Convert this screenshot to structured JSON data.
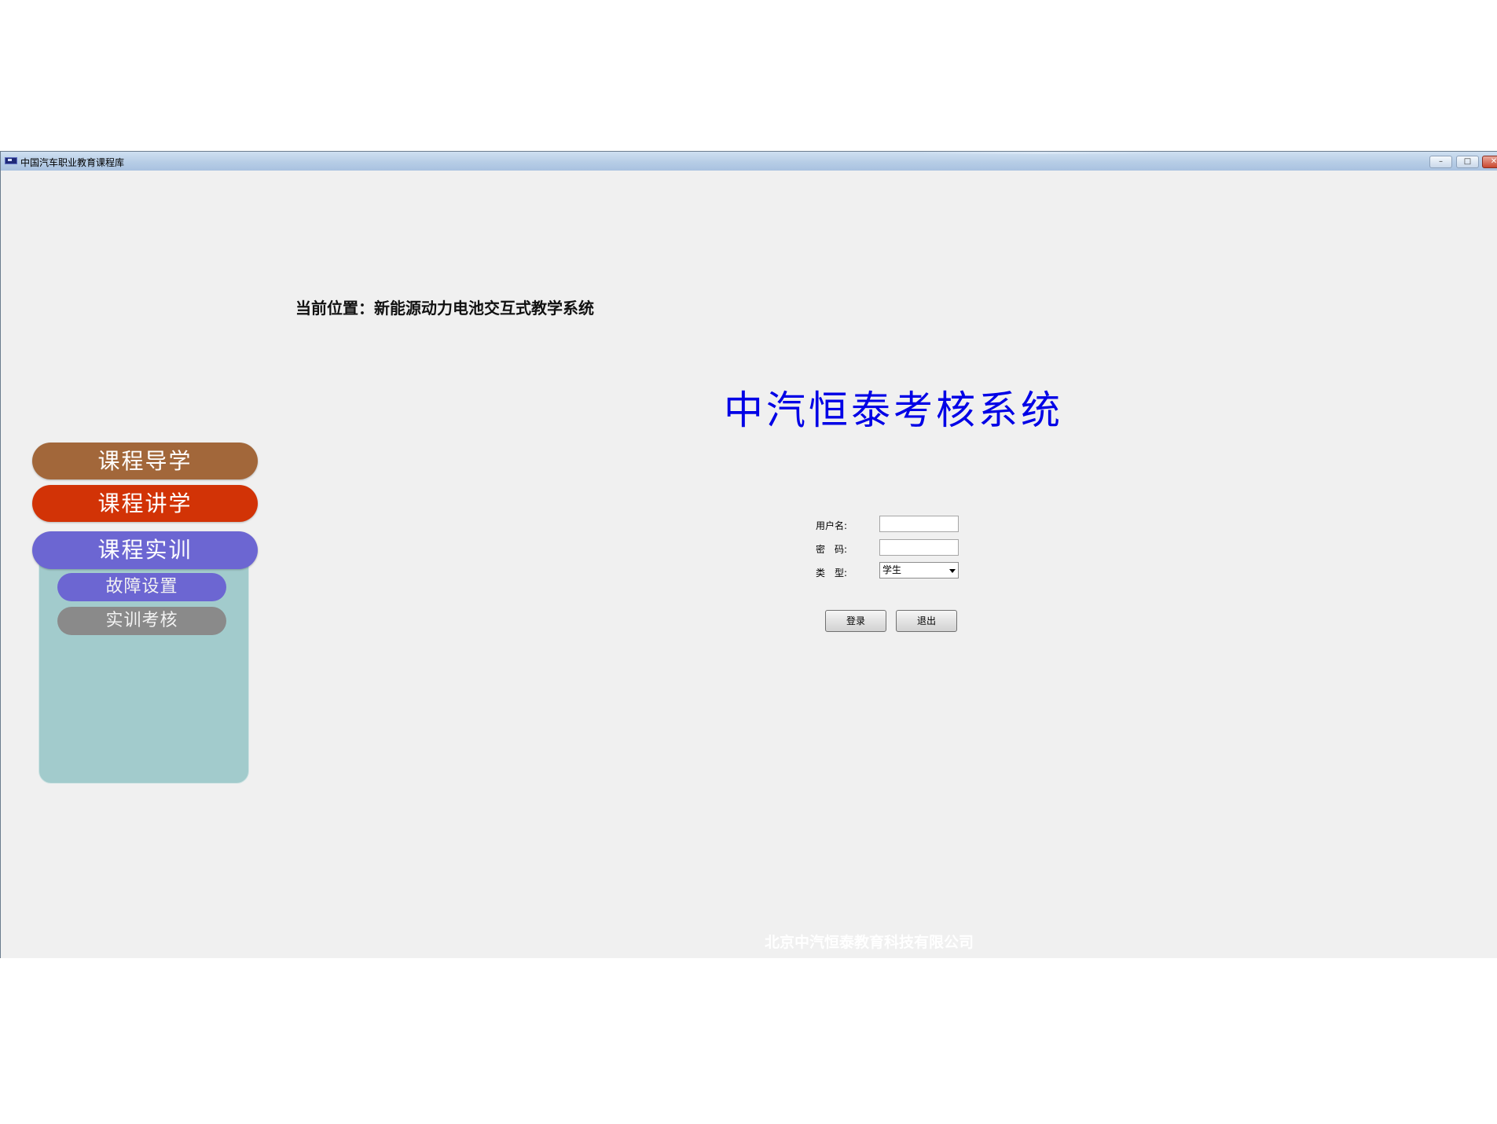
{
  "window": {
    "title": "中国汽车职业教育课程库",
    "controls": {
      "minimize": "–",
      "maximize": "□",
      "close": "✕"
    }
  },
  "breadcrumb": "当前位置：新能源动力电池交互式教学系统",
  "system_title": "中汽恒泰考核系统",
  "nav": {
    "course_guide": "课程导学",
    "course_lecture": "课程讲学",
    "course_training": "课程实训",
    "sub_items": {
      "fault_setting": "故障设置",
      "training_exam": "实训考核"
    }
  },
  "login_form": {
    "username_label": "用户名:",
    "username_value": "",
    "password_label": "密　码:",
    "password_value": "",
    "type_label": "类　型:",
    "type_selected": "学生",
    "login_button": "登录",
    "exit_button": "退出"
  },
  "footer": "北京中汽恒泰教育科技有限公司",
  "colors": {
    "title_blue": "#0000e6",
    "nav_guide": "#a2673a",
    "nav_lecture": "#d23306",
    "nav_training": "#6c66d2",
    "sub_panel": "#a2cbcc",
    "sub_inactive": "#8a8a8a"
  }
}
